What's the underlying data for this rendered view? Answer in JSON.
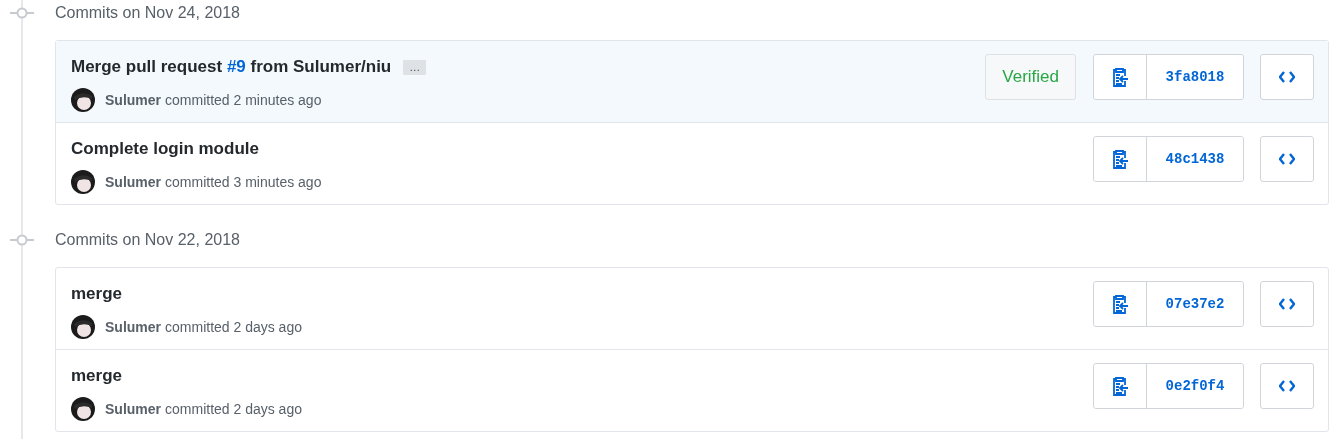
{
  "groups": [
    {
      "heading": "Commits on Nov 24, 2018",
      "commits": [
        {
          "title": [
            {
              "kind": "text",
              "text": "Merge pull request "
            },
            {
              "kind": "link",
              "text": "#9"
            },
            {
              "kind": "text",
              "text": " from Sulumer/niu"
            }
          ],
          "expander": "…",
          "highlighted": true,
          "author": "Sulumer",
          "action": "committed 2 minutes ago",
          "badge": "Verified",
          "sha": "3fa8018"
        },
        {
          "title": [
            {
              "kind": "text",
              "text": "Complete login module"
            }
          ],
          "highlighted": false,
          "author": "Sulumer",
          "action": "committed 3 minutes ago",
          "sha": "48c1438"
        }
      ]
    },
    {
      "heading": "Commits on Nov 22, 2018",
      "commits": [
        {
          "title": [
            {
              "kind": "text",
              "text": "merge"
            }
          ],
          "highlighted": false,
          "author": "Sulumer",
          "action": "committed 2 days ago",
          "sha": "07e37e2"
        },
        {
          "title": [
            {
              "kind": "text",
              "text": "merge"
            }
          ],
          "highlighted": false,
          "author": "Sulumer",
          "action": "committed 2 days ago",
          "sha": "0e2f0f4"
        }
      ]
    }
  ]
}
